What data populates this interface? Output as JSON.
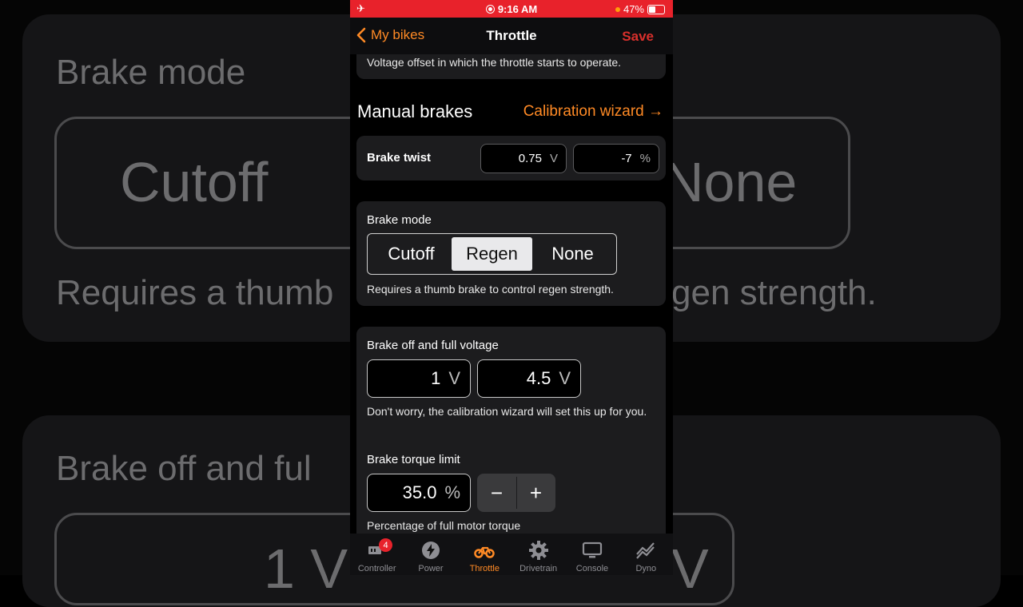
{
  "status": {
    "time": "9:16 AM",
    "battery": "47%"
  },
  "nav": {
    "back": "My bikes",
    "title": "Throttle",
    "save": "Save"
  },
  "offset_note": "Voltage offset in which the throttle starts to operate.",
  "manual_brakes": {
    "title": "Manual brakes",
    "wizard": "Calibration wizard →",
    "brake_twist": {
      "label": "Brake twist",
      "volt": "0.75",
      "volt_unit": "V",
      "pct": "-7",
      "pct_unit": "%"
    }
  },
  "brake_mode": {
    "label": "Brake mode",
    "options": [
      "Cutoff",
      "Regen",
      "None"
    ],
    "selected": "Regen",
    "note": "Requires a thumb brake to control regen strength."
  },
  "brake_voltage": {
    "label": "Brake off and full voltage",
    "off": "1",
    "full": "4.5",
    "unit": "V",
    "note": "Don't worry, the calibration wizard will set this up for you."
  },
  "torque": {
    "label": "Brake torque limit",
    "value": "35.0",
    "unit": "%",
    "minus": "−",
    "plus": "+",
    "note": "Percentage of full motor torque"
  },
  "tabs": [
    {
      "label": "Controller",
      "badge": "4"
    },
    {
      "label": "Power"
    },
    {
      "label": "Throttle"
    },
    {
      "label": "Drivetrain"
    },
    {
      "label": "Console"
    },
    {
      "label": "Dyno"
    }
  ],
  "bg": {
    "brake_mode": "Brake mode",
    "cutoff": "Cutoff",
    "none": "None",
    "requires": "Requires a thumb",
    "strength": "gen strength.",
    "brake_off": "Brake off and ful",
    "v1": "1 V",
    "v2": "V"
  },
  "colors": {
    "accent": "#ff8a25",
    "status_bar": "#e8222b",
    "save": "#d9302c"
  }
}
